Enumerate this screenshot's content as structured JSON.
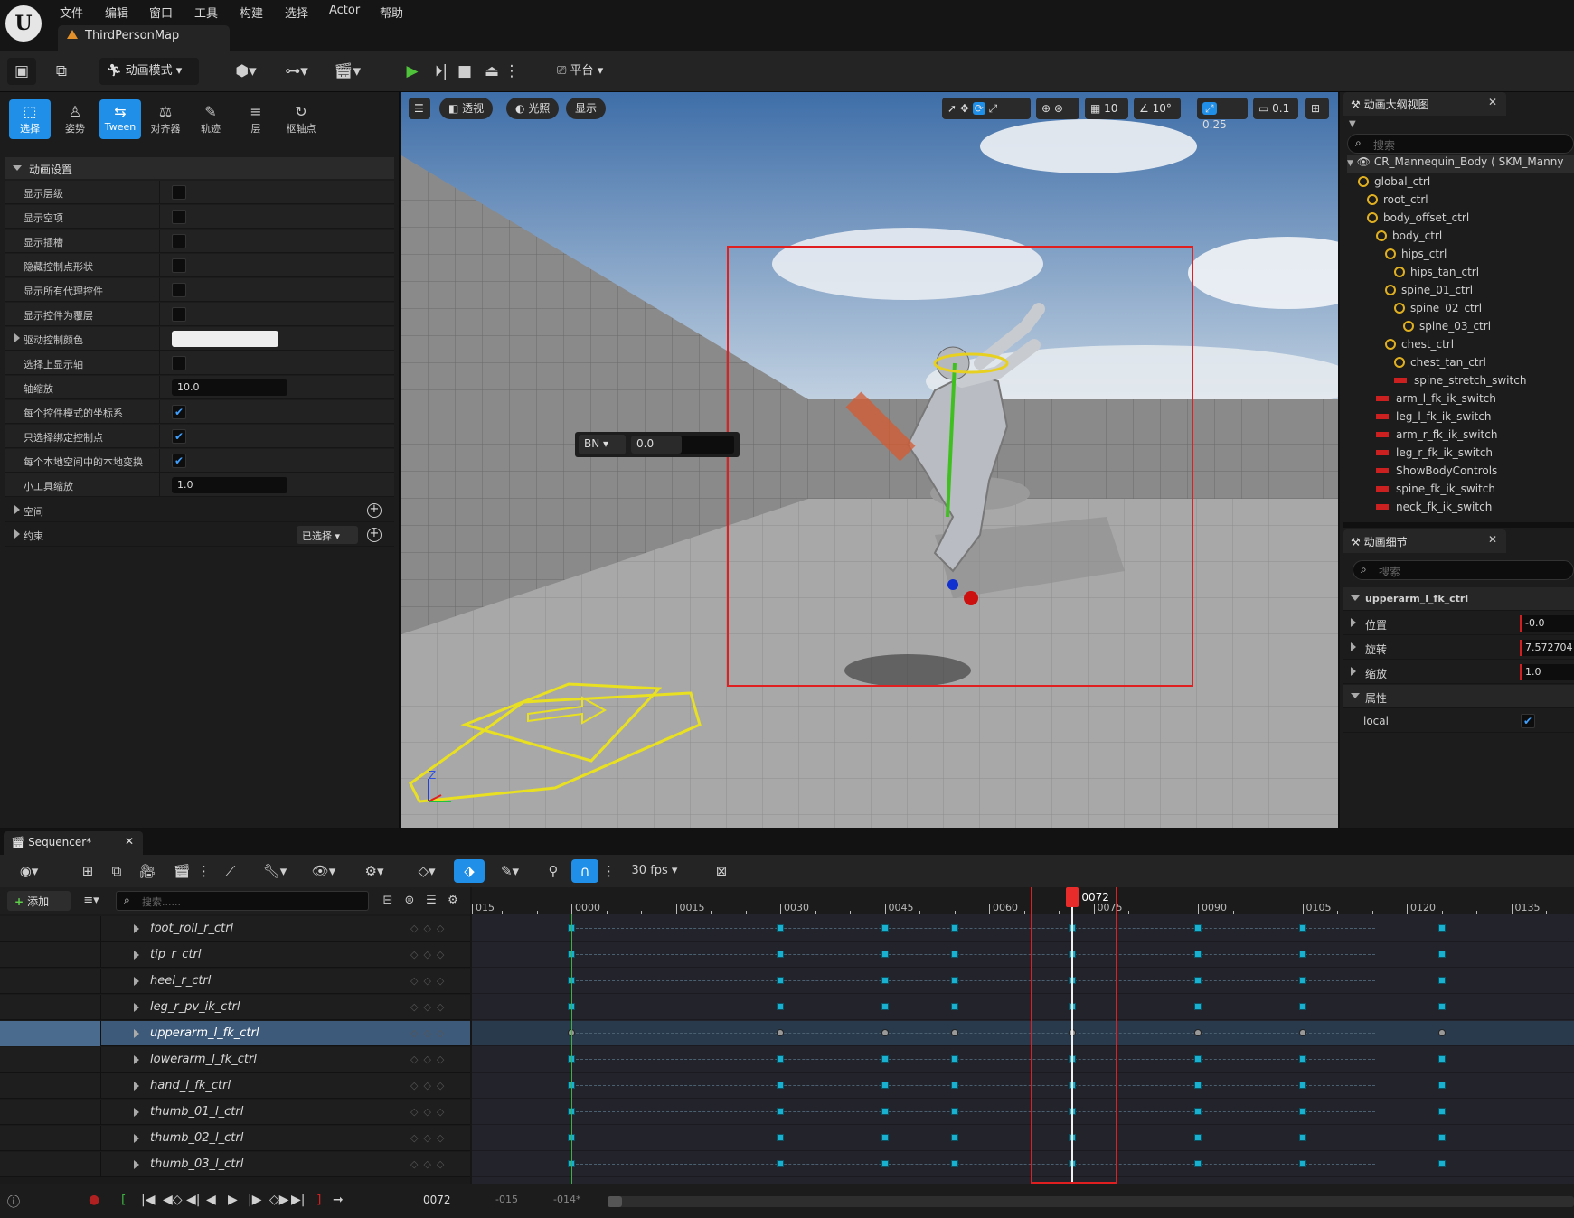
{
  "app": {
    "logo": "U"
  },
  "menu": [
    "文件",
    "编辑",
    "窗口",
    "工具",
    "构建",
    "选择",
    "Actor",
    "帮助"
  ],
  "document_tab": "ThirdPersonMap",
  "toolbar": {
    "mode_label": "动画模式",
    "platform_label": "平台"
  },
  "left_panel": {
    "modes": [
      {
        "icon": "select-icon",
        "glyph": "⬚",
        "label": "选择",
        "active": true
      },
      {
        "icon": "pose-icon",
        "glyph": "♙",
        "label": "姿势",
        "active": false
      },
      {
        "icon": "tween-icon",
        "glyph": "⇆",
        "label": "Tween",
        "active": true
      },
      {
        "icon": "aligner-icon",
        "glyph": "⚖",
        "label": "对齐器",
        "active": false
      },
      {
        "icon": "trail-icon",
        "glyph": "✎",
        "label": "轨迹",
        "active": false
      },
      {
        "icon": "layer-icon",
        "glyph": "≡",
        "label": "层",
        "active": false
      },
      {
        "icon": "pivot-icon",
        "glyph": "↻",
        "label": "枢轴点",
        "active": false
      }
    ],
    "section_title": "动画设置",
    "rows": [
      {
        "label": "显示层级",
        "type": "check",
        "checked": false
      },
      {
        "label": "显示空项",
        "type": "check",
        "checked": false
      },
      {
        "label": "显示插槽",
        "type": "check",
        "checked": false
      },
      {
        "label": "隐藏控制点形状",
        "type": "check",
        "checked": false
      },
      {
        "label": "显示所有代理控件",
        "type": "check",
        "checked": false
      },
      {
        "label": "显示控件为覆层",
        "type": "check",
        "checked": false
      },
      {
        "label": "驱动控制颜色",
        "type": "color",
        "expandable": true
      },
      {
        "label": "选择上显示轴",
        "type": "check",
        "checked": false
      },
      {
        "label": "轴缩放",
        "type": "number",
        "value": "10.0"
      },
      {
        "label": "每个控件模式的坐标系",
        "type": "check",
        "checked": true
      },
      {
        "label": "只选择绑定控制点",
        "type": "check",
        "checked": true
      },
      {
        "label": "每个本地空间中的本地变换",
        "type": "check",
        "checked": true
      },
      {
        "label": "小工具缩放",
        "type": "number",
        "value": "1.0"
      }
    ],
    "space_label": "空间",
    "constraint_label": "约束",
    "constraint_dropdown": "已选择"
  },
  "viewport": {
    "view_mode": "透视",
    "lighting": "光照",
    "show": "显示",
    "grid_snap": "10",
    "rot_snap": "10°",
    "scale_snap": "0.25",
    "camera_speed": "0.1",
    "overlay_space": "BN",
    "overlay_value": "0.0"
  },
  "outliner": {
    "tab_title": "动画大纲视图",
    "search_placeholder": "搜索",
    "root": "CR_Mannequin_Body ( SKM_Manny",
    "items": [
      {
        "label": "global_ctrl",
        "kind": "bone",
        "depth": 1
      },
      {
        "label": "root_ctrl",
        "kind": "bone",
        "depth": 2
      },
      {
        "label": "body_offset_ctrl",
        "kind": "bone",
        "depth": 2
      },
      {
        "label": "body_ctrl",
        "kind": "bone",
        "depth": 3
      },
      {
        "label": "hips_ctrl",
        "kind": "bone",
        "depth": 4
      },
      {
        "label": "hips_tan_ctrl",
        "kind": "bone",
        "depth": 5
      },
      {
        "label": "spine_01_ctrl",
        "kind": "bone",
        "depth": 4
      },
      {
        "label": "spine_02_ctrl",
        "kind": "bone",
        "depth": 5
      },
      {
        "label": "spine_03_ctrl",
        "kind": "bone",
        "depth": 6
      },
      {
        "label": "chest_ctrl",
        "kind": "bone",
        "depth": 4
      },
      {
        "label": "chest_tan_ctrl",
        "kind": "bone",
        "depth": 5
      },
      {
        "label": "spine_stretch_switch",
        "kind": "switch",
        "depth": 5
      },
      {
        "label": "arm_l_fk_ik_switch",
        "kind": "switch",
        "depth": 3
      },
      {
        "label": "leg_l_fk_ik_switch",
        "kind": "switch",
        "depth": 3
      },
      {
        "label": "arm_r_fk_ik_switch",
        "kind": "switch",
        "depth": 3
      },
      {
        "label": "leg_r_fk_ik_switch",
        "kind": "switch",
        "depth": 3
      },
      {
        "label": "ShowBodyControls",
        "kind": "switch",
        "depth": 3
      },
      {
        "label": "spine_fk_ik_switch",
        "kind": "switch",
        "depth": 3
      },
      {
        "label": "neck_fk_ik_switch",
        "kind": "switch",
        "depth": 3
      }
    ]
  },
  "details": {
    "tab_title": "动画细节",
    "search_placeholder": "搜索",
    "section": "upperarm_l_fk_ctrl",
    "rows": [
      {
        "label": "位置",
        "value": "-0.0"
      },
      {
        "label": "旋转",
        "value": "7.572704"
      },
      {
        "label": "缩放",
        "value": "1.0"
      }
    ],
    "attr_section": "属性",
    "attr_label": "local"
  },
  "sequencer": {
    "tab_title": "Sequencer*",
    "fps": "30 fps",
    "add_label": "添加",
    "search_placeholder": "搜索......",
    "tracks": [
      "foot_roll_r_ctrl",
      "tip_r_ctrl",
      "heel_r_ctrl",
      "leg_r_pv_ik_ctrl",
      "upperarm_l_fk_ctrl",
      "lowerarm_l_fk_ctrl",
      "hand_l_fk_ctrl",
      "thumb_01_l_ctrl",
      "thumb_02_l_ctrl",
      "thumb_03_l_ctrl"
    ],
    "selected_track": 4,
    "ruler_labels": [
      "015",
      "0000",
      "0015",
      "0030",
      "0045",
      "0060",
      "0075",
      "0090",
      "0105",
      "0120",
      "0135"
    ],
    "current_frame": "0072",
    "key_frames": [
      0,
      30,
      45,
      55,
      72,
      90,
      105,
      125
    ],
    "transport": {
      "frame": "0072",
      "start": "-015",
      "end": "-014*"
    }
  }
}
